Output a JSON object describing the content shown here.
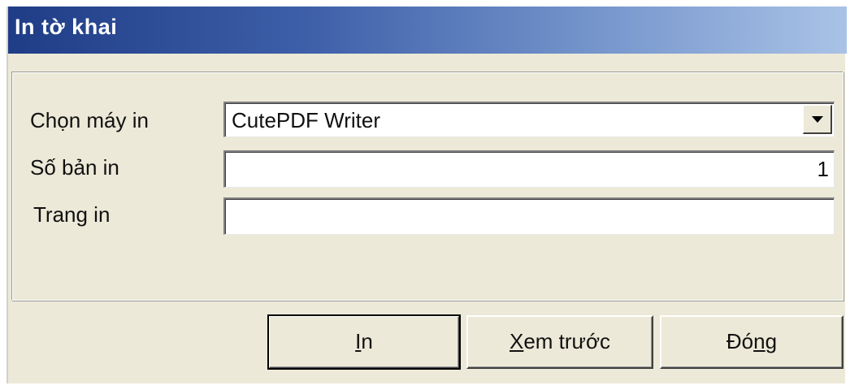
{
  "window": {
    "title": "In tờ khai"
  },
  "form": {
    "printer_label": "Chọn máy in",
    "printer_value": "CutePDF Writer",
    "copies_label": "Số bản in",
    "copies_value": "1",
    "pages_label": "Trang in",
    "pages_value": ""
  },
  "buttons": {
    "print": {
      "mnemonic": "I",
      "rest": "n"
    },
    "preview": {
      "mnemonic": "X",
      "rest": "em trước"
    },
    "close": {
      "prefix": "Đó",
      "mnemonic": "n",
      "rest": "g"
    }
  },
  "icons": {
    "dropdown": "chevron-down-icon"
  },
  "colors": {
    "title_gradient_start": "#1f3d86",
    "title_gradient_end": "#a9c2e6",
    "dialog_background": "#ece9d8"
  }
}
